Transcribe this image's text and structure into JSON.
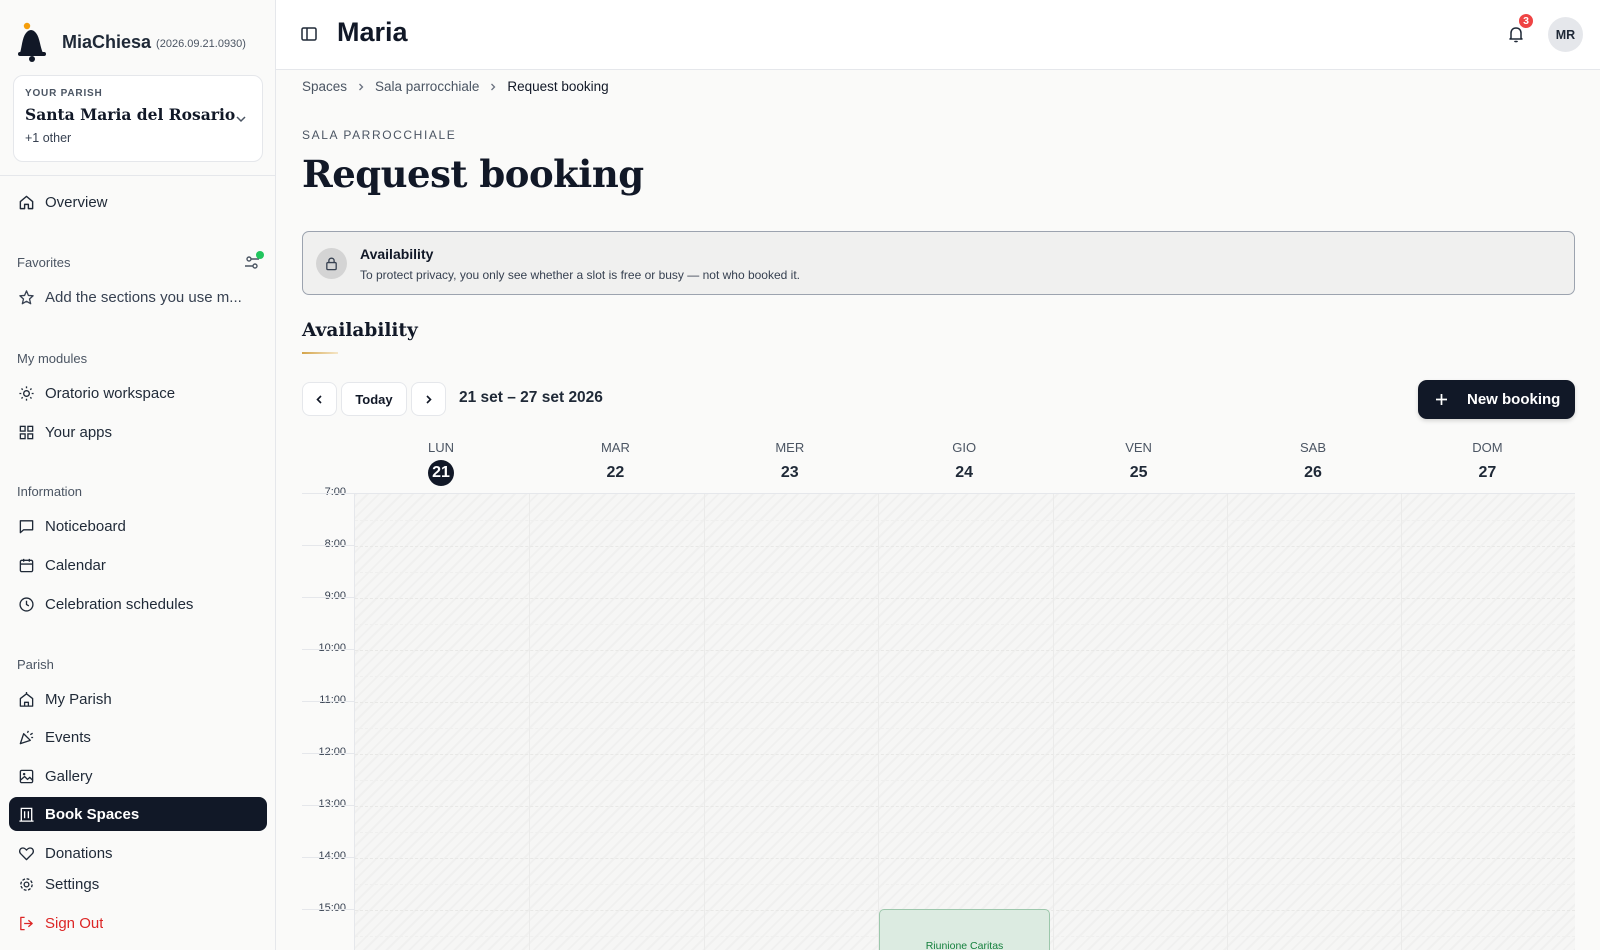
{
  "app": {
    "name": "MiaChiesa",
    "version": "(2026.09.21.0930)"
  },
  "parish": {
    "eyebrow": "YOUR PARISH",
    "name": "Santa Maria del Rosario",
    "other": "+1 other"
  },
  "sidebar": {
    "overview": "Overview",
    "favorites_label": "Favorites",
    "favorites_hint": "Add the sections you use m...",
    "modules_label": "My modules",
    "modules": [
      "Oratorio workspace",
      "Your apps"
    ],
    "information_label": "Information",
    "information": [
      "Noticeboard",
      "Calendar",
      "Celebration schedules"
    ],
    "parish_label": "Parish",
    "parish_items": [
      "My Parish",
      "Events",
      "Gallery",
      "Book Spaces",
      "Donations"
    ],
    "settings": "Settings",
    "signout": "Sign Out"
  },
  "header": {
    "title": "Maria",
    "notifications": "3",
    "avatar": "MR"
  },
  "breadcrumb": [
    "Spaces",
    "Sala parrocchiale",
    "Request booking"
  ],
  "page": {
    "eyebrow": "SALA PARROCCHIALE",
    "title": "Request booking"
  },
  "notice": {
    "title": "Availability",
    "text": "To protect privacy, you only see whether a slot is free or busy — not who booked it."
  },
  "section": {
    "title": "Availability"
  },
  "toolbar": {
    "today": "Today",
    "range": "21 set – 27 set 2026",
    "new_booking": "New booking"
  },
  "calendar": {
    "days": [
      {
        "name": "LUN",
        "num": "21",
        "today": true
      },
      {
        "name": "MAR",
        "num": "22"
      },
      {
        "name": "MER",
        "num": "23"
      },
      {
        "name": "GIO",
        "num": "24"
      },
      {
        "name": "VEN",
        "num": "25"
      },
      {
        "name": "SAB",
        "num": "26"
      },
      {
        "name": "DOM",
        "num": "27"
      }
    ],
    "hours": [
      "7:00",
      "8:00",
      "9:00",
      "10:00",
      "11:00",
      "12:00",
      "13:00",
      "14:00",
      "15:00"
    ],
    "event": {
      "title": "Riunione Caritas",
      "day": "GIO",
      "start": "15:00"
    }
  },
  "colors": {
    "accent": "#111827",
    "notice_bg": "#f0f0ef",
    "event_bg": "#dcebe1",
    "event_text": "#15803d",
    "danger": "#dc2626",
    "success_dot": "#22c55e"
  }
}
